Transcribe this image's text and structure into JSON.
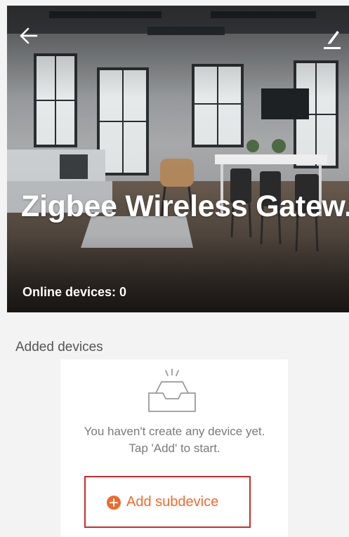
{
  "header": {
    "back_icon": "arrow-left-icon",
    "edit_icon": "pencil-icon"
  },
  "gateway": {
    "title": "Zigbee Wireless Gatew...",
    "online_devices": "Online devices: 0"
  },
  "devices": {
    "section_label": "Added devices",
    "empty_icon": "empty-inbox-icon",
    "empty_line_1": "You haven't create any device yet.",
    "empty_line_2": "Tap 'Add' to start.",
    "add_button_label": "Add subdevice",
    "add_icon": "plus-circle-icon"
  },
  "colors": {
    "accent": "#f26a2a",
    "highlight_border": "#cc2a2a",
    "background": "#f3f3f3"
  }
}
